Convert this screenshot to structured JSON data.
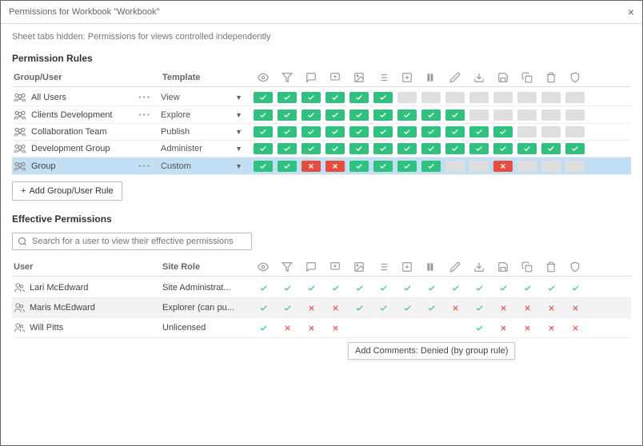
{
  "title": "Permissions for Workbook \"Workbook\"",
  "subtext": "Sheet tabs hidden: Permissions for views controlled independently",
  "sections": {
    "rules_title": "Permission Rules",
    "effective_title": "Effective Permissions"
  },
  "headers": {
    "group_user": "Group/User",
    "template": "Template",
    "user": "User",
    "site_role": "Site Role"
  },
  "add_button": "Add Group/User Rule",
  "search_placeholder": "Search for a user to view their effective permissions",
  "tooltip": "Add Comments: Denied (by group rule)",
  "capability_icons": [
    "view-icon",
    "filter-icon",
    "comments-icon",
    "add-comments-icon",
    "image-icon",
    "summary-icon",
    "web-edit-icon",
    "tag-icon",
    "edit-icon",
    "download-icon",
    "save-icon",
    "move-icon",
    "delete-icon",
    "set-permissions-icon"
  ],
  "rules": [
    {
      "name": "All Users",
      "template": "View",
      "caps": [
        "a",
        "a",
        "a",
        "a",
        "a",
        "a",
        "u",
        "u",
        "u",
        "u",
        "u",
        "u",
        "u",
        "u"
      ],
      "more": true
    },
    {
      "name": "Clients Development",
      "template": "Explore",
      "caps": [
        "a",
        "a",
        "a",
        "a",
        "a",
        "a",
        "a",
        "a",
        "a",
        "u",
        "u",
        "u",
        "u",
        "u"
      ],
      "more": true
    },
    {
      "name": "Collaboration Team",
      "template": "Publish",
      "caps": [
        "a",
        "a",
        "a",
        "a",
        "a",
        "a",
        "a",
        "a",
        "a",
        "a",
        "a",
        "u",
        "u",
        "u"
      ],
      "more": false
    },
    {
      "name": "Development Group",
      "template": "Administer",
      "caps": [
        "a",
        "a",
        "a",
        "a",
        "a",
        "a",
        "a",
        "a",
        "a",
        "a",
        "a",
        "a",
        "a",
        "a"
      ],
      "more": false
    },
    {
      "name": "Group",
      "template": "Custom",
      "caps": [
        "a",
        "a",
        "d",
        "d",
        "a",
        "a",
        "a",
        "a",
        "u",
        "u",
        "d",
        "u",
        "u",
        "u"
      ],
      "more": true,
      "selected": true
    }
  ],
  "users": [
    {
      "name": "Lari McEdward",
      "role": "Site Administrat...",
      "caps": [
        "a",
        "a",
        "a",
        "a",
        "a",
        "a",
        "a",
        "a",
        "a",
        "a",
        "a",
        "a",
        "a",
        "a"
      ]
    },
    {
      "name": "Maris McEdward",
      "role": "Explorer (can pu...",
      "caps": [
        "a",
        "a",
        "d",
        "d",
        "a",
        "a",
        "a",
        "a",
        "d",
        "a",
        "d",
        "d",
        "d",
        "d"
      ],
      "hover": true
    },
    {
      "name": "Will Pitts",
      "role": "Unlicensed",
      "caps": [
        "a",
        "d",
        "d",
        "d",
        "",
        "",
        "",
        "",
        "",
        "a",
        "d",
        "d",
        "d",
        "d"
      ]
    }
  ]
}
